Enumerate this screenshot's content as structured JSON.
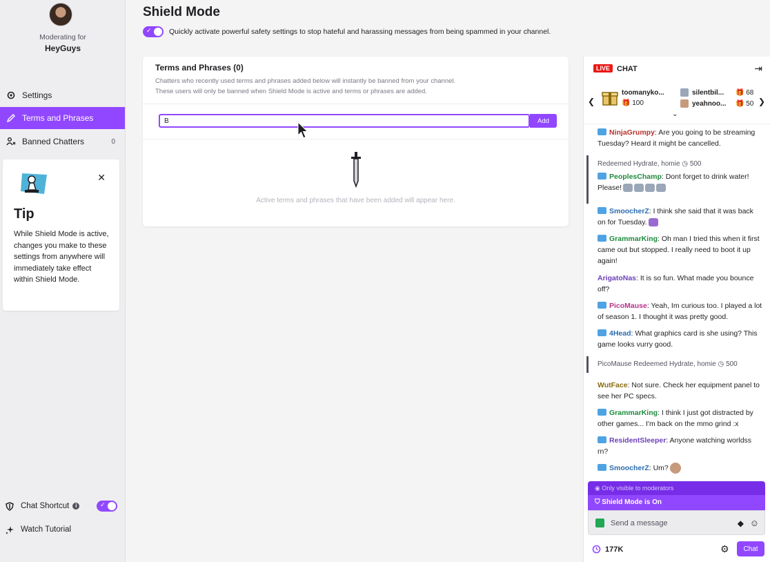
{
  "sidebar": {
    "moderating_label": "Moderating for",
    "channel_name": "HeyGuys",
    "nav": [
      {
        "label": "Settings",
        "icon": "gear-icon"
      },
      {
        "label": "Terms and Phrases",
        "icon": "pencil-icon"
      },
      {
        "label": "Banned Chatters",
        "icon": "banned-users-icon",
        "count": "0"
      }
    ],
    "tip": {
      "title": "Tip",
      "body": "While Shield Mode is active, changes you make to these settings from anywhere will immediately take effect within Shield Mode."
    },
    "chat_shortcut_label": "Chat Shortcut",
    "chat_shortcut_on": true,
    "watch_tutorial_label": "Watch Tutorial"
  },
  "main": {
    "title": "Shield Mode",
    "toggle_on": true,
    "description": "Quickly activate powerful safety settings to stop hateful and harassing messages from being spammed in your channel.",
    "card": {
      "title": "Terms and Phrases (0)",
      "subtitle_1": "Chatters who recently used terms and phrases added below will instantly be banned from your channel.",
      "subtitle_2": "These users will only be banned when Shield Mode is active and terms or phrases are added.",
      "input_value": "B",
      "add_label": "Add",
      "empty_text": "Active terms and phrases that have been added will appear here."
    }
  },
  "chat": {
    "live_label": "LIVE",
    "title": "CHAT",
    "gifters": [
      {
        "name": "toomanyko...",
        "count": "100"
      },
      {
        "name": "silentbil...",
        "count": "68"
      },
      {
        "name": "yeahnoo...",
        "count": "50"
      }
    ],
    "messages": [
      {
        "user": "NinjaGrumpy",
        "color": "#b5332e",
        "text": ": Are you going to be streaming Tuesday? Heard it might be cancelled."
      },
      {
        "redeem": "Redeemed Hydrate, homie",
        "cost": "500"
      },
      {
        "user": "PeoplesChamp",
        "color": "#1e8a3c",
        "text": ": Dont forget to drink water! Please!"
      },
      {
        "user": "SmoocherZ",
        "color": "#2b6cb0",
        "text": ": I think she said that it was back on for Tuesday."
      },
      {
        "user": "GrammarKing",
        "color": "#1e8a3c",
        "text": ": Oh man I tried this when it first came out but stopped. I really need to boot it up again!"
      },
      {
        "user": "ArigatoNas",
        "color": "#6b3fb8",
        "text": ": It is so fun. What made you bounce off?"
      },
      {
        "user": "PicoMause",
        "color": "#b5338a",
        "text": ": Yeah, Im curious too. I played a lot of season 1. I thought it was pretty good."
      },
      {
        "user": "4Head",
        "color": "#2b6cb0",
        "text": ": What graphics card is she using? This game looks vurry good."
      },
      {
        "redeem": "PicoMause Redeemed Hydrate, homie",
        "cost": "500"
      },
      {
        "user": "WutFace",
        "color": "#8a6a10",
        "text": ": Not sure. Check her equipment panel to see her PC specs."
      },
      {
        "user": "GrammarKing",
        "color": "#1e8a3c",
        "text": ": I think I just got distracted by other games... I'm back on the mmo grind :x"
      },
      {
        "user": "ResidentSleeper",
        "color": "#6b3fb8",
        "text": ": Anyone watching worldss rn?"
      },
      {
        "user": "SmoocherZ",
        "color": "#2b6cb0",
        "text": ": Um?"
      }
    ],
    "mod_only_label": "Only visible to moderators",
    "shield_status": "Shield Mode is On",
    "input_placeholder": "Send a message",
    "viewer_count": "177K",
    "send_label": "Chat"
  },
  "colors": {
    "accent": "#9147ff",
    "live": "#e91916"
  }
}
